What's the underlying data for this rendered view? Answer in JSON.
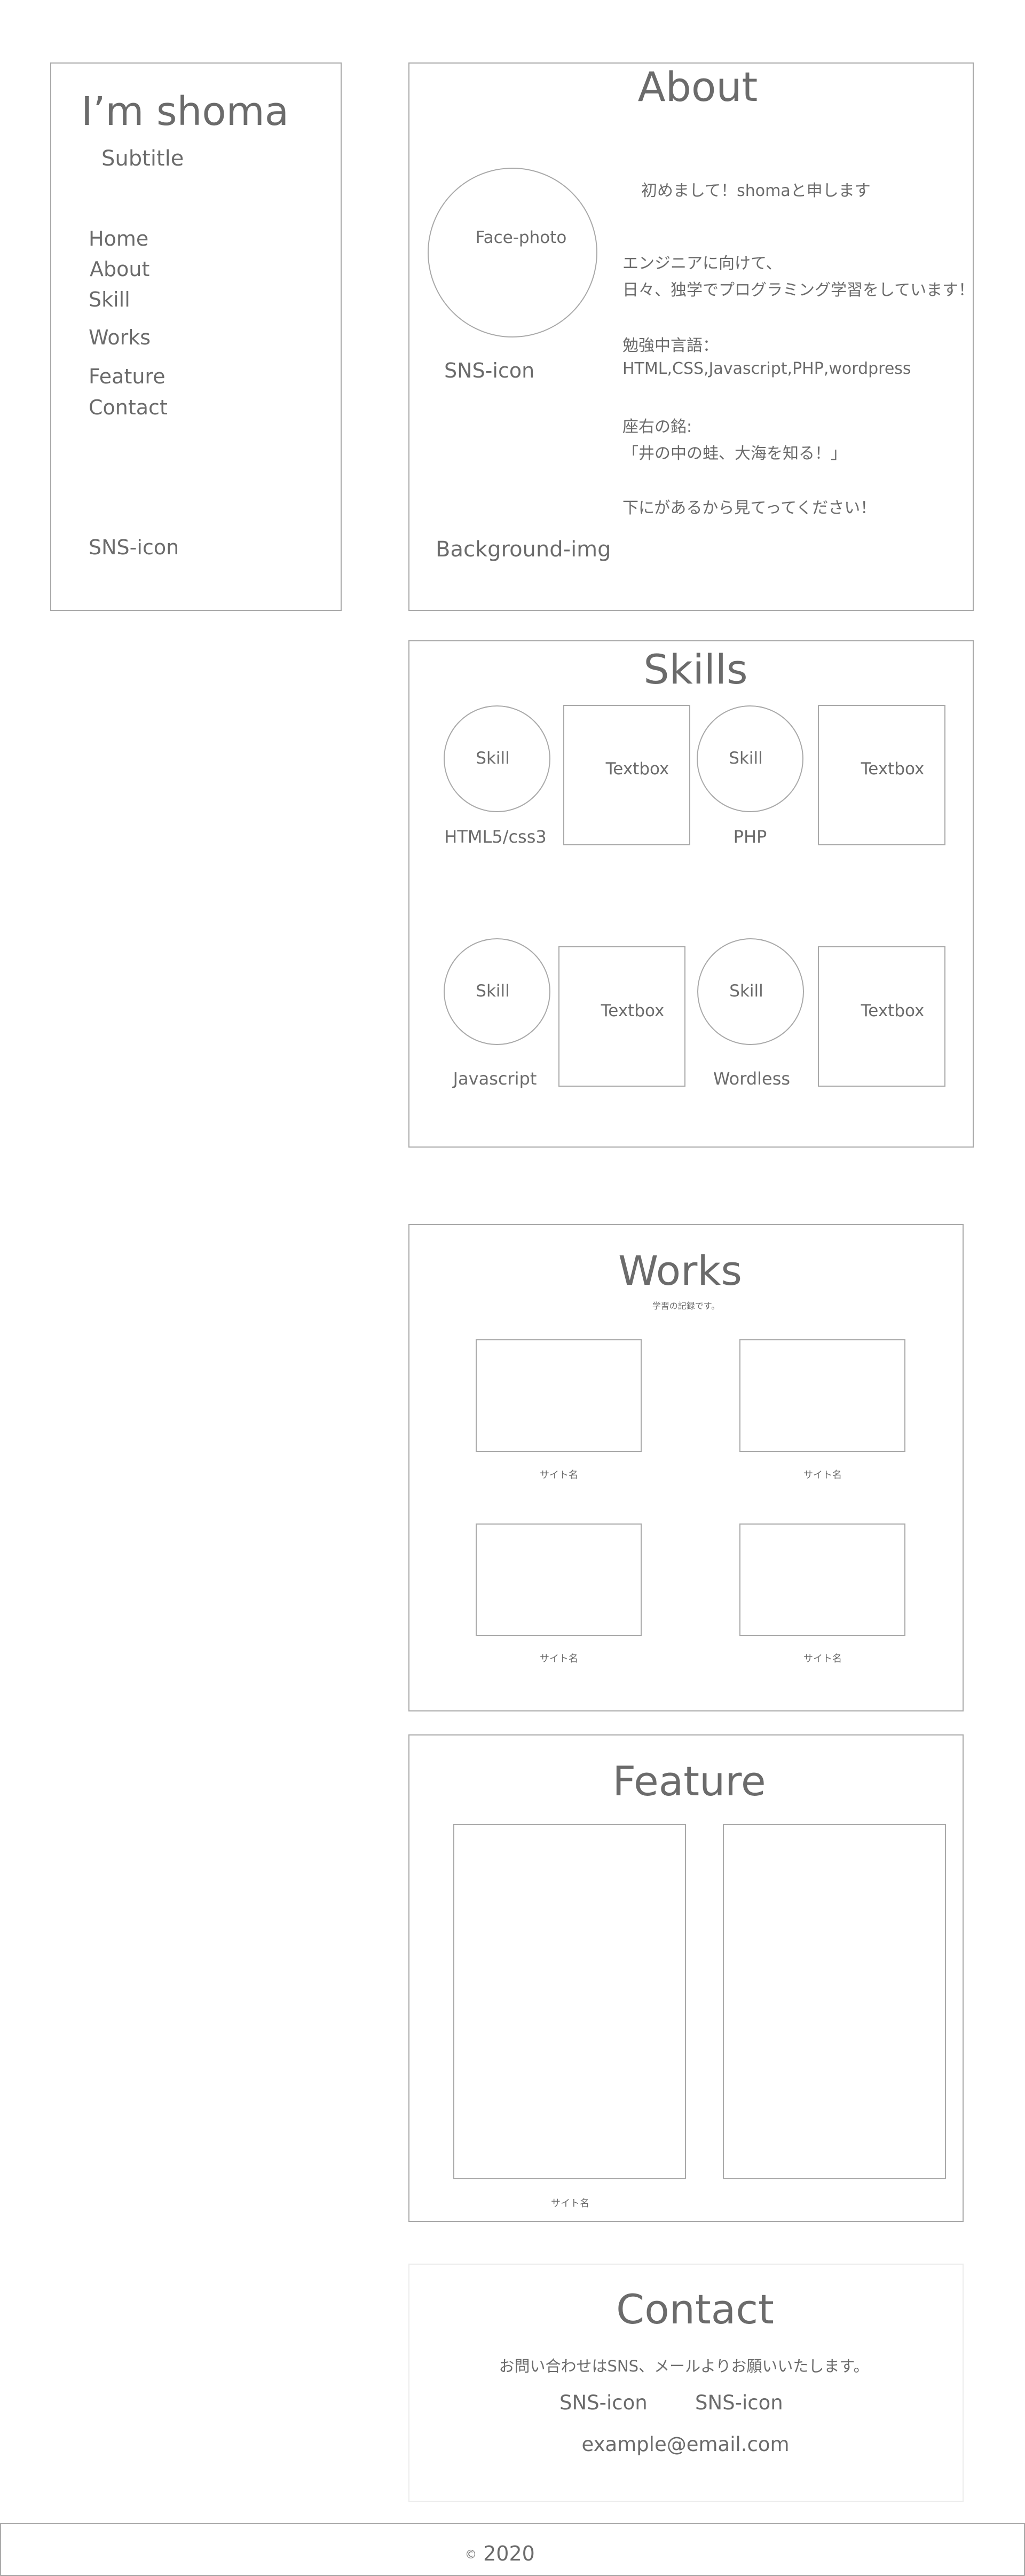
{
  "sidebar": {
    "name": "I’m shoma",
    "subtitle": "Subtitle",
    "nav": [
      "Home",
      "About",
      "Skill",
      "Works",
      "Feature",
      "Contact"
    ],
    "sns": "SNS-icon"
  },
  "about": {
    "title": "About",
    "face_photo": "Face-photo",
    "sns": "SNS-icon",
    "background": "Background-img",
    "greeting": "初めまして！shomaと申します",
    "lines": [
      "エンジニアに向けて、",
      "日々、独学でプログラミング学習をしています！",
      "勉強中言語：",
      "HTML,CSS,Javascript,PHP,wordpress",
      "座右の銘:",
      "「井の中の蛙、大海を知る！」",
      "下にがあるから見てってください！"
    ]
  },
  "skills": {
    "title": "Skills",
    "items": [
      {
        "circle": "Skill",
        "name": "HTML5/css3",
        "textbox": "Textbox"
      },
      {
        "circle": "Skill",
        "name": "PHP",
        "textbox": "Textbox"
      },
      {
        "circle": "Skill",
        "name": "Javascript",
        "textbox": "Textbox"
      },
      {
        "circle": "Skill",
        "name": "Wordless",
        "textbox": "Textbox"
      }
    ]
  },
  "works": {
    "title": "Works",
    "subtitle": "学習の記録です。",
    "items": [
      "サイト名",
      "サイト名",
      "サイト名",
      "サイト名"
    ]
  },
  "feature": {
    "title": "Feature",
    "caption": "サイト名"
  },
  "contact": {
    "title": "Contact",
    "text": "お問い合わせはSNS、メールよりお願いいたします。",
    "sns": [
      "SNS-icon",
      "SNS-icon"
    ],
    "email": "example@email.com"
  },
  "footer": {
    "copyright_symbol": "©",
    "year": "2020"
  }
}
